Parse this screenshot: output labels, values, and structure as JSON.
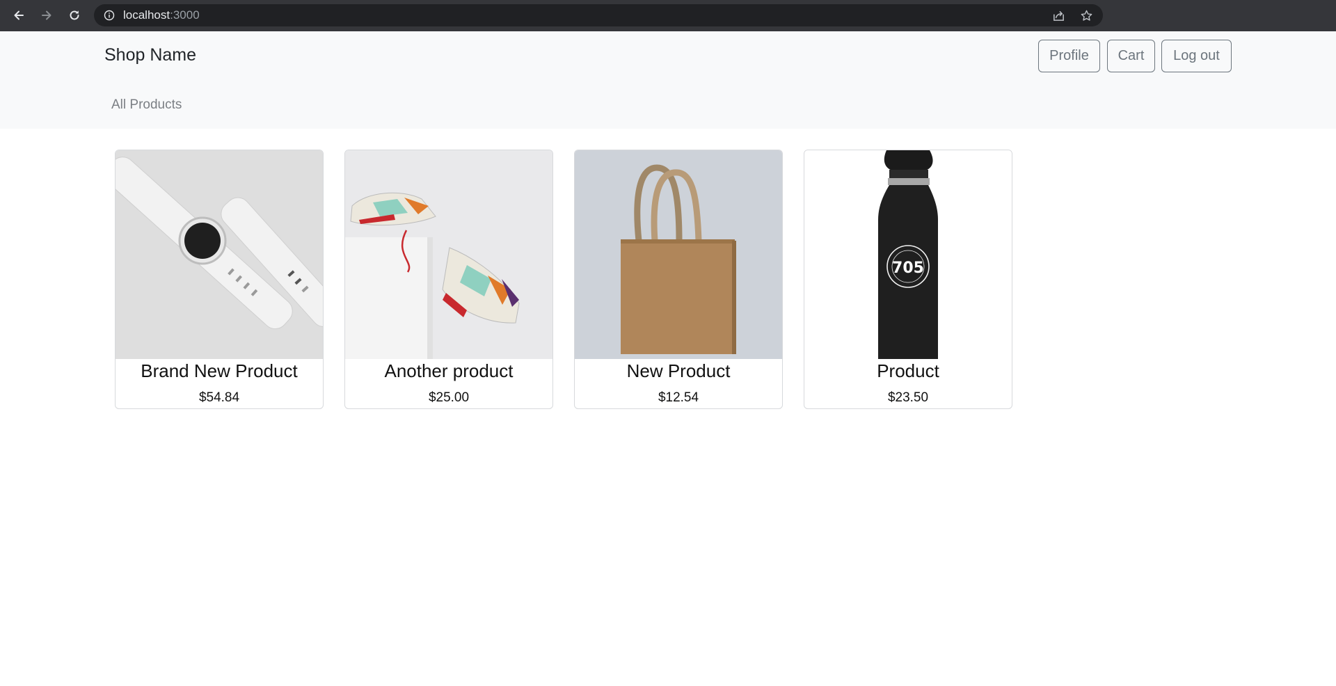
{
  "browser": {
    "url_host": "localhost",
    "url_port": ":3000",
    "icons": {
      "back": "back-arrow-icon",
      "forward": "forward-arrow-icon",
      "reload": "reload-icon",
      "info": "info-icon",
      "share": "share-icon",
      "bookmark": "star-icon"
    }
  },
  "header": {
    "brand": "Shop Name",
    "buttons": {
      "profile": "Profile",
      "cart": "Cart",
      "logout": "Log out"
    },
    "nav_link": "All Products"
  },
  "products": [
    {
      "name": "Brand New Product",
      "price": "$54.84",
      "image": "smartwatch-photo"
    },
    {
      "name": "Another product",
      "price": "$25.00",
      "image": "sneakers-photo"
    },
    {
      "name": "New Product",
      "price": "$12.54",
      "image": "tote-bag-photo"
    },
    {
      "name": "Product",
      "price": "$23.50",
      "image": "water-bottle-photo"
    }
  ],
  "colors": {
    "chrome_bg": "#35363a",
    "omnibox_bg": "#202124",
    "header_bg": "#f8f9fa",
    "button_outline": "#6c757d",
    "card_border": "#d7d9dc"
  }
}
